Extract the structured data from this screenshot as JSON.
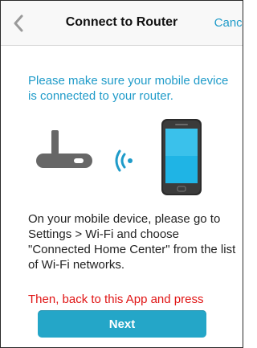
{
  "header": {
    "title": "Connect to Router",
    "cancel_label": "Cance",
    "back_icon": "chevron-left-icon"
  },
  "body": {
    "intro": "Please make sure your mobile device is connected to your router.",
    "instructions": "On your mobile device, please go to Settings > Wi-Fi and choose \"Connected Home Center\" from the list of Wi-Fi networks.",
    "warning": "Then, back to this App and press",
    "next_label": "Next"
  },
  "illustration": {
    "router_icon": "router-icon",
    "signal_icon": "wifi-signal-icon",
    "phone_icon": "smartphone-icon"
  },
  "colors": {
    "accent": "#1f9bc9",
    "button": "#24a6c8",
    "warning": "#e01414"
  }
}
